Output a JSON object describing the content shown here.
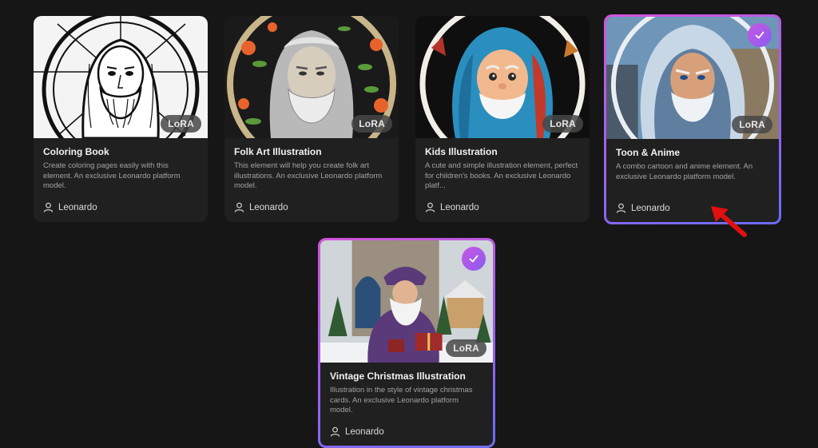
{
  "badge_label": "LoRA",
  "cards": [
    {
      "title": "Coloring Book",
      "description": "Create coloring pages easily with this element. An exclusive Leonardo platform model.",
      "author": "Leonardo",
      "selected": false,
      "image": "stained-glass line-art bearded man portrait"
    },
    {
      "title": "Folk Art Illustration",
      "description": "This element will help you create folk art illustrations. An exclusive Leonardo platform model.",
      "author": "Leonardo",
      "selected": false,
      "image": "folk art bearded man with flowers portrait"
    },
    {
      "title": "Kids Illustration",
      "description": "A cute and simple illustration element, perfect for children's books. An exclusive Leonardo platf...",
      "author": "Leonardo",
      "selected": false,
      "image": "cartoon bearded man with blue hair portrait"
    },
    {
      "title": "Toon & Anime",
      "description": "A combo cartoon and anime element. An exclusive Leonardo platform model.",
      "author": "Leonardo",
      "selected": true,
      "image": "anime style hooded bearded man portrait"
    },
    {
      "title": "Vintage Christmas Illustration",
      "description": "Illustration in the style of vintage christmas cards. An exclusive Leonardo platform model.",
      "author": "Leonardo",
      "selected": true,
      "image": "vintage christmas bearded man with gift in snow"
    }
  ],
  "colors": {
    "background": "#161616",
    "card": "#202020",
    "selected_border_start": "#d455d8",
    "selected_border_end": "#6b6cf5",
    "annotation_arrow": "#e01010"
  }
}
